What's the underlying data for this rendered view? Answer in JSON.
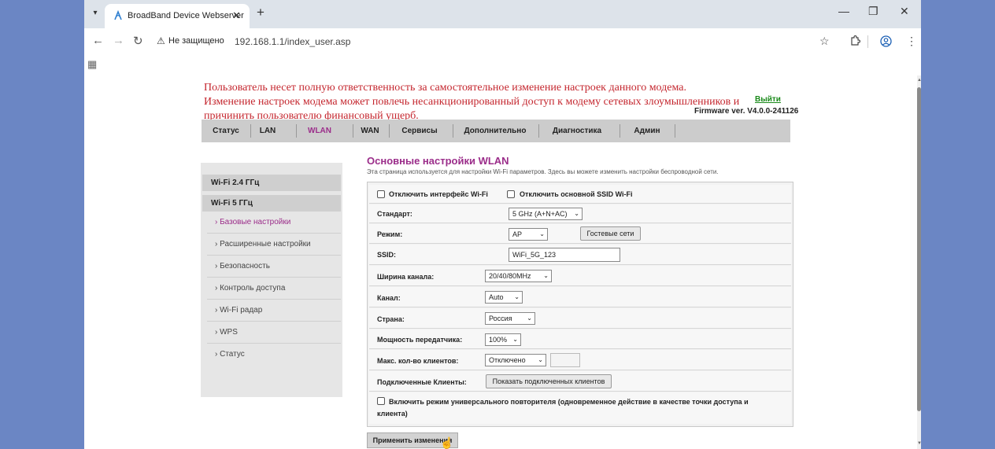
{
  "browser": {
    "tab_title": "BroadBand Device Webserver",
    "close_glyph": "✕",
    "newtab_glyph": "+",
    "minimize_glyph": "—",
    "restore_glyph": "❐",
    "win_close_glyph": "✕",
    "security_label": "Не защищено",
    "url": "192.168.1.1/index_user.asp",
    "icons": [
      "tab-list-icon",
      "favicon-icon",
      "back-icon",
      "forward-icon",
      "reload-icon",
      "warning-icon",
      "star-icon",
      "extensions-icon",
      "profile-icon",
      "menu-icon",
      "apps-icon"
    ]
  },
  "header": {
    "warning_lines": [
      "Пользователь несет полную ответственность за самостоятельное изменение настроек данного модема.",
      "Изменение настроек модема может повлечь несанкционированный доступ к модему сетевых злоумышленников и",
      "причинить пользователю финансовый ущерб."
    ],
    "logout": "Выйти",
    "firmware": "Firmware ver. V4.0.0-241126"
  },
  "nav": {
    "items": [
      "Статус",
      "LAN",
      "WLAN",
      "WAN",
      "Сервисы",
      "Дополнительно",
      "Диагностика",
      "Админ"
    ],
    "active": "WLAN"
  },
  "sidebar": {
    "sections": [
      "Wi-Fi 2.4 ГГц",
      "Wi-Fi 5 ГГц"
    ],
    "items": [
      "› Базовые настройки",
      "› Расширенные настройки",
      "› Безопасность",
      "› Контроль доступа",
      "› Wi-Fi радар",
      "› WPS",
      "› Статус"
    ],
    "active_item": "› Базовые настройки"
  },
  "content": {
    "title": "Основные настройки WLAN",
    "description": "Эта страница используется для настройки Wi-Fi параметров. Здесь вы можете изменить настройки беспроводной сети.",
    "disable_iface": "Отключить интерфейс Wi-Fi",
    "disable_ssid": "Отключить основной SSID Wi-Fi",
    "standard_label": "Стандарт:",
    "standard_value": "5 GHz (A+N+AC)",
    "mode_label": "Режим:",
    "mode_value": "AP",
    "guest_button": "Гостевые сети",
    "ssid_label": "SSID:",
    "ssid_value": "WiFi_5G_123",
    "width_label": "Ширина канала:",
    "width_value": "20/40/80MHz",
    "channel_label": "Канал:",
    "channel_value": "Auto",
    "country_label": "Страна:",
    "country_value": "Россия",
    "power_label": "Мощность передатчика:",
    "power_value": "100%",
    "maxclients_label": "Макс. кол-во клиентов:",
    "maxclients_value": "Отключено",
    "clients_label": "Подключенные Клиенты:",
    "clients_button": "Показать подключенных клиентов",
    "repeater_label_1": "Включить режим универсального повторителя (одновременное действие в качестве точки доступа и",
    "repeater_label_2": "клиента)",
    "apply_button": "Применить изменения"
  }
}
